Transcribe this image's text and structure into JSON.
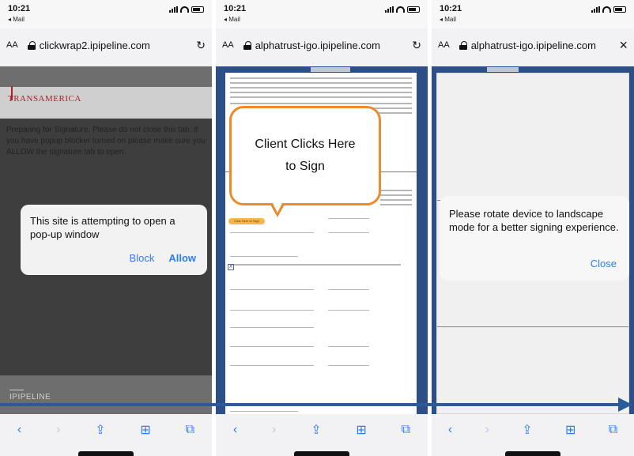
{
  "status": {
    "time": "10:21",
    "back_app": "◂ Mail"
  },
  "panels": [
    {
      "url": "clickwrap2.ipipeline.com",
      "aa": "AA",
      "logo": "TRANSAMERICA",
      "prep_text": "Preparing for Signature. Please do not close this tab. If you have popup blocker turned on please make sure you ALLOW the signature tab to open.",
      "popup": {
        "message": "This site is attempting to open a pop-up window",
        "block": "Block",
        "allow": "Allow"
      },
      "footer_brand": "IPIPELINE"
    },
    {
      "url": "alphatrust-igo.ipipeline.com",
      "aa": "AA",
      "callout_text": "Client Clicks Here to Sign",
      "sign_here": "Click Here to Sign",
      "checkbox_mark": "X"
    },
    {
      "url": "alphatrust-igo.ipipeline.com",
      "aa": "AA",
      "rotate": {
        "message": "Please rotate device to landscape mode for a better signing experience.",
        "close": "Close"
      }
    }
  ],
  "toolbar_icons": [
    "back-icon",
    "forward-icon",
    "share-icon",
    "bookmarks-icon",
    "tabs-icon"
  ],
  "colors": {
    "accent": "#2e7cf6",
    "callout_border": "#eb8b2e",
    "arrow": "#2d5a9a",
    "doc_bg": "#2d4f88"
  }
}
